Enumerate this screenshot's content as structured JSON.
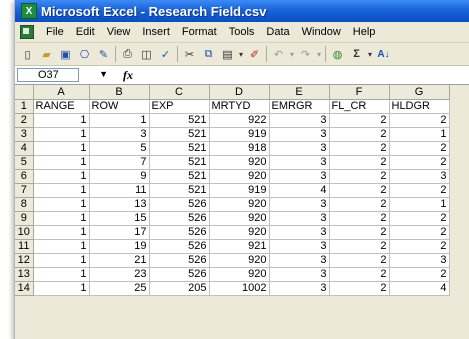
{
  "window": {
    "title": "Microsoft Excel - Research Field.csv"
  },
  "menu": [
    "File",
    "Edit",
    "View",
    "Insert",
    "Format",
    "Tools",
    "Data",
    "Window",
    "Help"
  ],
  "toolbar": {
    "items": [
      {
        "name": "new-icon",
        "glyph": "▯"
      },
      {
        "name": "open-icon",
        "glyph": "📂"
      },
      {
        "name": "save-icon",
        "glyph": "▣"
      },
      {
        "name": "permission-icon",
        "glyph": "⎔"
      },
      {
        "name": "research-icon",
        "glyph": "✎"
      },
      {
        "name": "print-icon",
        "glyph": "⎙"
      },
      {
        "name": "print-preview-icon",
        "glyph": "🔍"
      },
      {
        "name": "spelling-icon",
        "glyph": "✓"
      },
      {
        "name": "cut-icon",
        "glyph": "✂"
      },
      {
        "name": "copy-icon",
        "glyph": "⧉"
      },
      {
        "name": "paste-icon",
        "glyph": "📋"
      },
      {
        "name": "format-painter-icon",
        "glyph": "✐"
      },
      {
        "name": "undo-icon",
        "glyph": "↶"
      },
      {
        "name": "redo-icon",
        "glyph": "↷"
      },
      {
        "name": "hyperlink-icon",
        "glyph": "🌐"
      },
      {
        "name": "autosum-icon",
        "glyph": "Σ"
      },
      {
        "name": "sort-ascending-icon",
        "glyph": "A↓"
      }
    ]
  },
  "formula_bar": {
    "name_box": "O37",
    "fx": "fx",
    "content": ""
  },
  "sheet": {
    "columns": [
      "A",
      "B",
      "C",
      "D",
      "E",
      "F",
      "G"
    ],
    "rows": [
      {
        "n": "1",
        "cells": [
          "RANGE",
          "ROW",
          "EXP",
          "MRTYD",
          "EMRGR",
          "FL_CR",
          "HLDGR"
        ]
      },
      {
        "n": "2",
        "cells": [
          "1",
          "1",
          "521",
          "922",
          "3",
          "2",
          "2"
        ]
      },
      {
        "n": "3",
        "cells": [
          "1",
          "3",
          "521",
          "919",
          "3",
          "2",
          "1"
        ]
      },
      {
        "n": "4",
        "cells": [
          "1",
          "5",
          "521",
          "918",
          "3",
          "2",
          "2"
        ]
      },
      {
        "n": "5",
        "cells": [
          "1",
          "7",
          "521",
          "920",
          "3",
          "2",
          "2"
        ]
      },
      {
        "n": "6",
        "cells": [
          "1",
          "9",
          "521",
          "920",
          "3",
          "2",
          "3"
        ]
      },
      {
        "n": "7",
        "cells": [
          "1",
          "11",
          "521",
          "919",
          "4",
          "2",
          "2"
        ]
      },
      {
        "n": "8",
        "cells": [
          "1",
          "13",
          "526",
          "920",
          "3",
          "2",
          "1"
        ]
      },
      {
        "n": "9",
        "cells": [
          "1",
          "15",
          "526",
          "920",
          "3",
          "2",
          "2"
        ]
      },
      {
        "n": "10",
        "cells": [
          "1",
          "17",
          "526",
          "920",
          "3",
          "2",
          "2"
        ]
      },
      {
        "n": "11",
        "cells": [
          "1",
          "19",
          "526",
          "921",
          "3",
          "2",
          "2"
        ]
      },
      {
        "n": "12",
        "cells": [
          "1",
          "21",
          "526",
          "920",
          "3",
          "2",
          "3"
        ]
      },
      {
        "n": "13",
        "cells": [
          "1",
          "23",
          "526",
          "920",
          "3",
          "2",
          "2"
        ]
      },
      {
        "n": "14",
        "cells": [
          "1",
          "25",
          "205",
          "1002",
          "3",
          "2",
          "4"
        ]
      }
    ]
  }
}
